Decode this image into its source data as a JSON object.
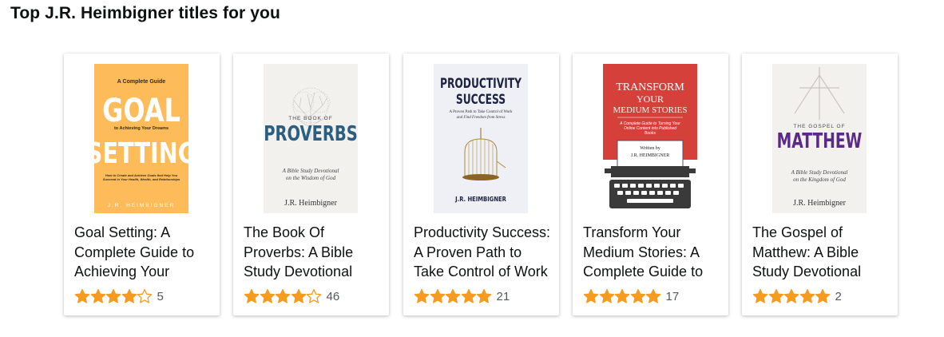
{
  "heading": "Top J.R. Heimbigner titles for you",
  "colors": {
    "star": "#f49b20",
    "star_outline": "#f49b20"
  },
  "books": [
    {
      "title": "Goal Setting: A Complete Guide to Achieving Your Dreams",
      "rating": 4,
      "review_count": "5",
      "cover": {
        "top_line": "A Complete Guide",
        "word1": "GOAL",
        "middle_line": "to Achieving Your Dreams",
        "word2": "SETTING",
        "blurb": "How to Create and Achieve Goals that Help You Succeed in Your Health, Wealth, and Relationships",
        "author": "J.R. HEIMBIGNER"
      }
    },
    {
      "title": "The Book Of Proverbs: A Bible Study Devotional",
      "rating": 4,
      "review_count": "46",
      "cover": {
        "pre": "THE BOOK OF",
        "main": "PROVERBS",
        "sub1": "A Bible Study Devotional",
        "sub2": "on the Wisdom of God",
        "author": "J.R. Heimbigner"
      }
    },
    {
      "title": "Productivity Success: A Proven Path to Take Control of Work",
      "rating": 5,
      "review_count": "21",
      "cover": {
        "line1": "PRODUCTIVITY",
        "line2": "SUCCESS",
        "sub1": "A Proven Path to Take Control of Work",
        "sub2": "and Find Freedom from Stress",
        "author": "J.R. HEIMBIGNER"
      }
    },
    {
      "title": "Transform Your Medium Stories: A Complete Guide to",
      "rating": 5,
      "review_count": "17",
      "cover": {
        "line1": "TRANSFORM",
        "line2": "YOUR",
        "line3": "MEDIUM STORIES",
        "sub1": "A Complete Guide to Turning Your",
        "sub2": "Online Content into Published",
        "sub3": "Books",
        "written": "Written by",
        "author": "J.R. HEIMBIGNER"
      }
    },
    {
      "title": "The Gospel of Matthew: A Bible Study Devotional",
      "rating": 5,
      "review_count": "2",
      "cover": {
        "pre": "THE GOSPEL OF",
        "main": "MATTHEW",
        "sub1": "A Bible Study Devotional",
        "sub2": "on the Kingdom of God",
        "author": "J.R. Heimbigner"
      }
    }
  ]
}
